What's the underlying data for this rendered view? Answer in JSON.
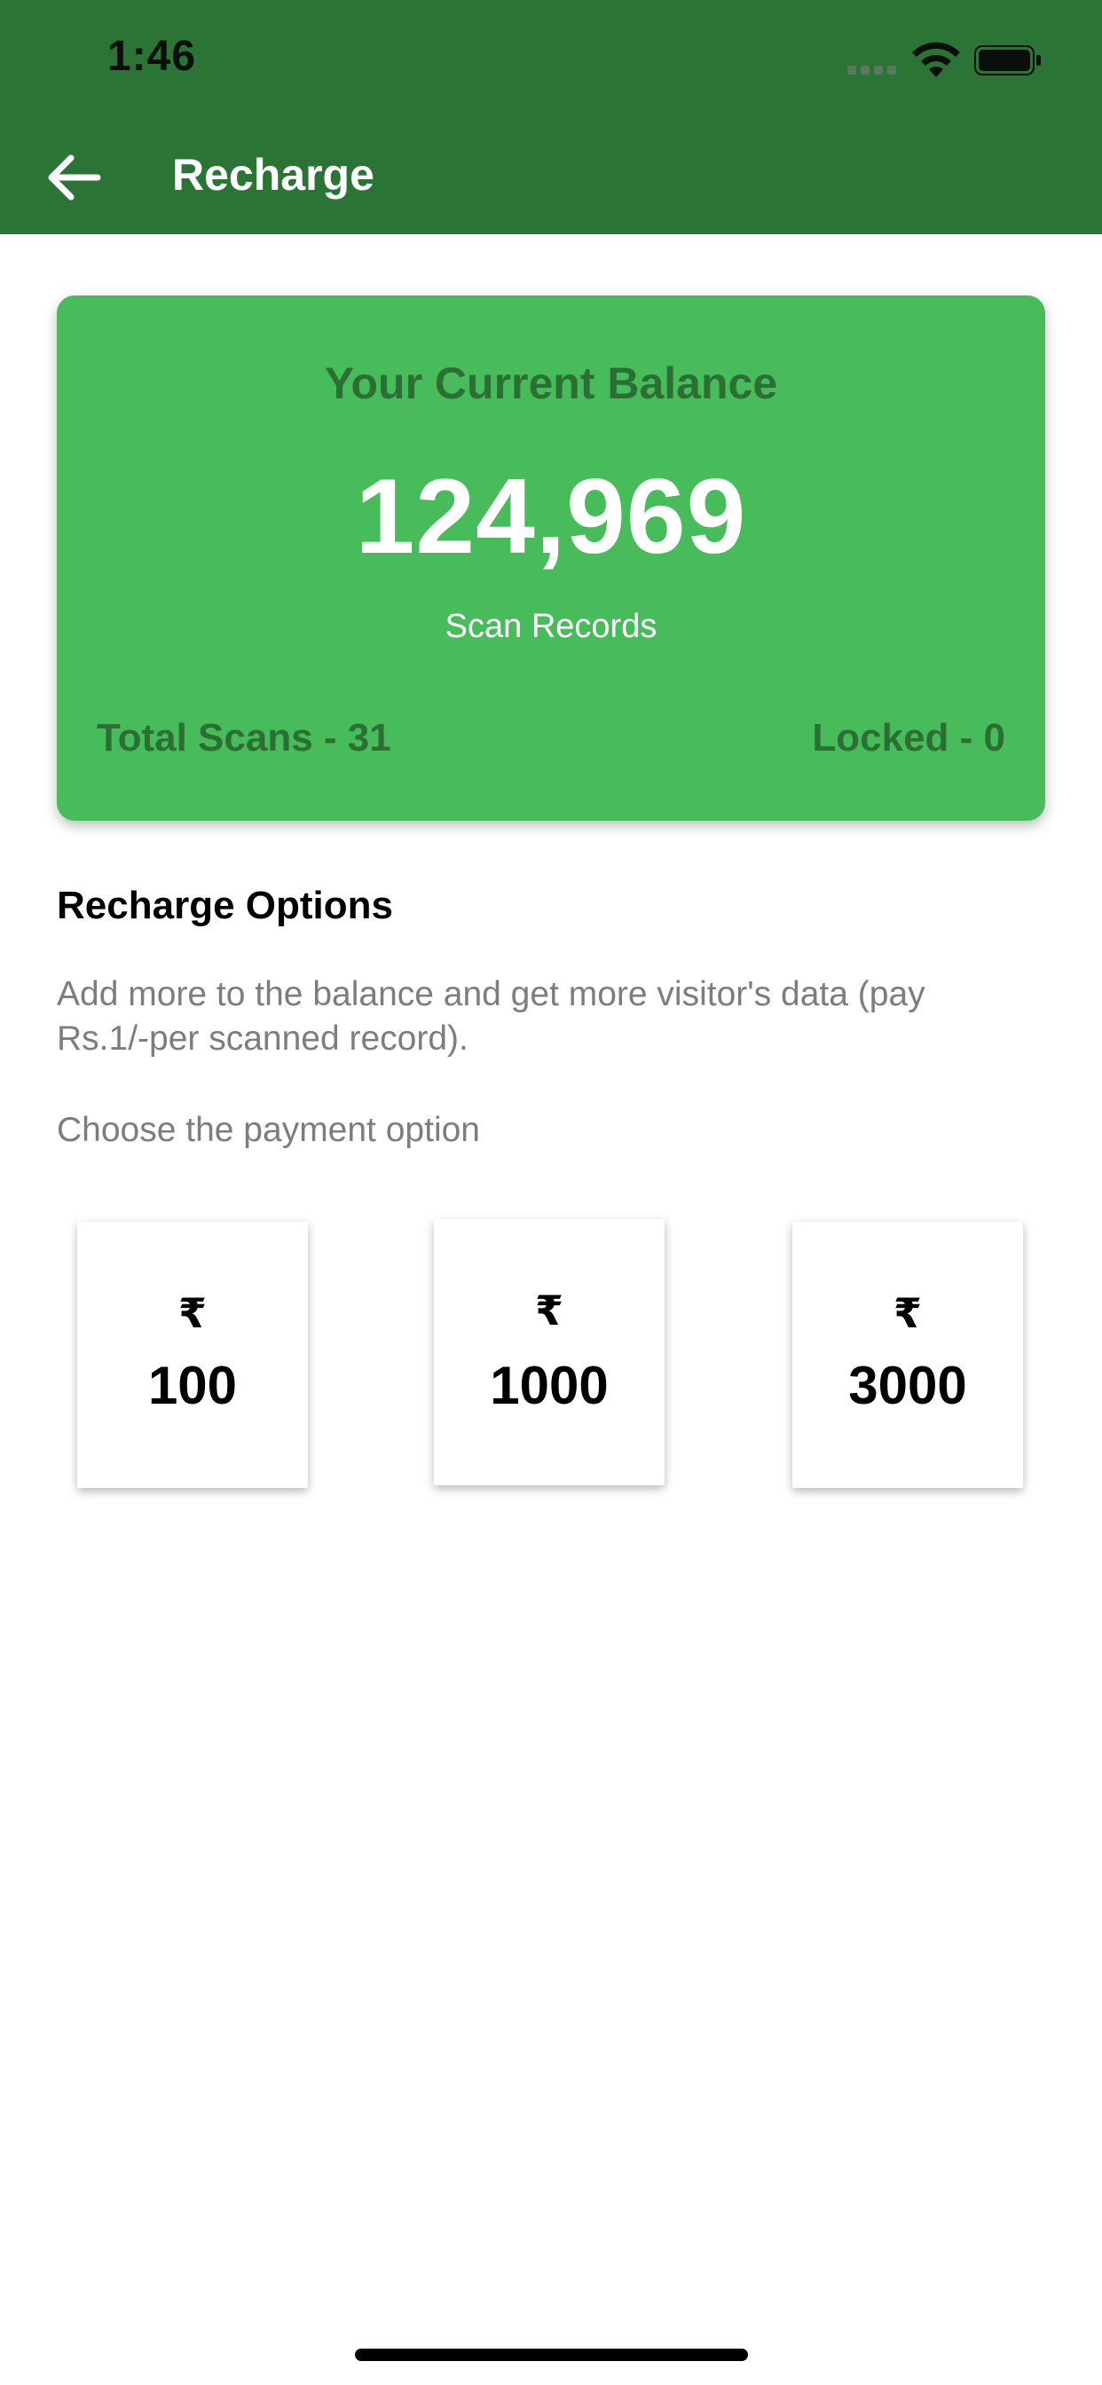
{
  "status_bar": {
    "time": "1:46"
  },
  "header": {
    "title": "Recharge",
    "back_icon": "arrow-left-icon",
    "background_color": "#2c7436"
  },
  "balance_card": {
    "title": "Your Current Balance",
    "value": "124,969",
    "unit_label": "Scan Records",
    "total_scans": "Total Scans - 31",
    "locked": "Locked - 0",
    "background_color": "#48bc5a"
  },
  "recharge": {
    "title": "Recharge Options",
    "description": "Add more to the balance and get more visitor's data (pay Rs.1/-per scanned record).",
    "choose_label": "Choose the payment option",
    "options": [
      {
        "currency": "₹",
        "amount": "100"
      },
      {
        "currency": "₹",
        "amount": "1000"
      },
      {
        "currency": "₹",
        "amount": "3000"
      }
    ]
  }
}
